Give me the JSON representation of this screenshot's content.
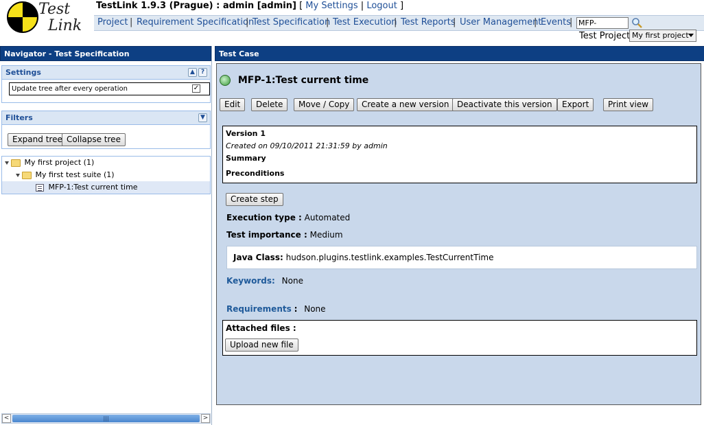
{
  "header": {
    "app_title": "TestLink 1.9.3 (Prague) : admin [admin]",
    "bracket_open": "[",
    "bracket_close": "]",
    "separator": "|",
    "my_settings": "My Settings",
    "logout": "Logout",
    "logo_text_top": "Test",
    "logo_text_bottom": "Link"
  },
  "menu": {
    "items": [
      "Project",
      "Requirement Specification",
      "Test Specification",
      "Test Execution",
      "Test Reports",
      "User Management",
      "Events"
    ],
    "search_value": "MFP-",
    "test_project_label": "Test Project",
    "test_project_selected": "My first project"
  },
  "navigator": {
    "title": "Navigator - Test Specification",
    "settings": {
      "title": "Settings",
      "collapse_icon": "▲",
      "help_icon": "?",
      "update_tree_label": "Update tree after every operation",
      "update_tree_checked": "✓"
    },
    "filters": {
      "title": "Filters",
      "expand_icon": "▼",
      "expand_tree": "Expand tree",
      "collapse_tree": "Collapse tree"
    },
    "tree": [
      {
        "label": "My first project (1)",
        "type": "folder"
      },
      {
        "label": "My first test suite (1)",
        "type": "folder"
      },
      {
        "label": "MFP-1:Test current time",
        "type": "testcase"
      }
    ],
    "scroll_grip": "|||",
    "scroll_left": "<",
    "scroll_right": ">"
  },
  "testcase": {
    "panel_title": "Test Case",
    "title": "MFP-1:Test current time",
    "buttons": [
      "Edit",
      "Delete",
      "Move / Copy",
      "Create a new version",
      "Deactivate this version",
      "Export",
      "Print view"
    ],
    "version_label": "Version 1",
    "created_line": "Created on 09/10/2011 21:31:59  by admin",
    "summary_label": "Summary",
    "preconditions_label": "Preconditions",
    "create_step": "Create step",
    "execution_type_label": "Execution type :",
    "execution_type_value": "Automated",
    "importance_label": "Test importance :",
    "importance_value": "Medium",
    "java_class_label": "Java Class:",
    "java_class_value": "hudson.plugins.testlink.examples.TestCurrentTime",
    "keywords_label": "Keywords:",
    "keywords_value": "None",
    "requirements_label": "Requirements",
    "requirements_colon": ":",
    "requirements_value": "None",
    "attached_files_label": "Attached files :",
    "upload_button": "Upload new file"
  },
  "colors": {
    "panel_title_bg": "#0d3f83",
    "content_bg": "#c9d8eb",
    "link": "#1f4f97",
    "section_head_bg": "#dae6f4"
  }
}
